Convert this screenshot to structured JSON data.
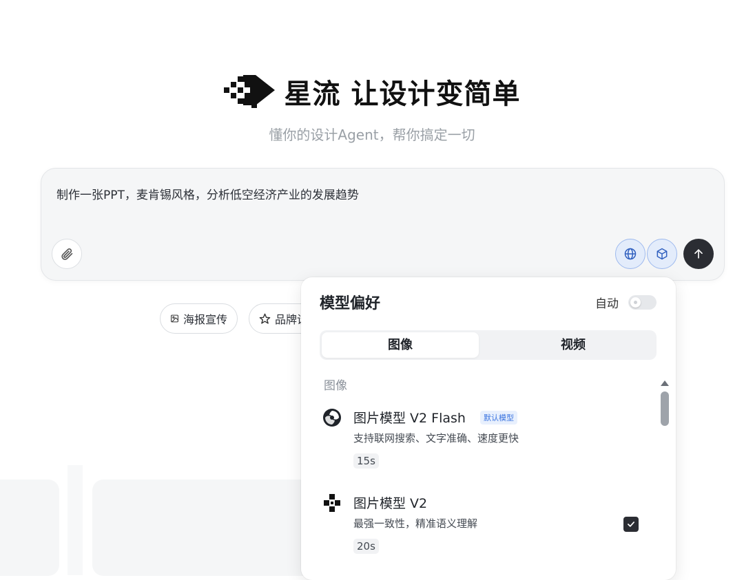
{
  "hero": {
    "logo_icon": "xingliu-logo-icon",
    "title": "星流 让设计变简单",
    "subtitle": "懂你的设计Agent，帮你搞定一切"
  },
  "composer": {
    "prompt": "制作一张PPT，麦肯锡风格，分析低空经济产业的发展趋势",
    "attach_icon": "paperclip-icon",
    "web_search_icon": "globe-icon",
    "model_icon": "cube-icon",
    "send_icon": "arrow-up-icon",
    "accent_color": "#9db9ee"
  },
  "chips": [
    {
      "label": "海报宣传",
      "icon": "image-icon"
    },
    {
      "label": "品牌设",
      "icon": "star-icon"
    }
  ],
  "model_panel": {
    "title": "模型偏好",
    "auto_label": "自动",
    "auto_enabled": false,
    "tabs": [
      {
        "label": "图像",
        "active": true
      },
      {
        "label": "视频",
        "active": false
      }
    ],
    "section_label": "图像",
    "models": [
      {
        "name": "图片模型 V2 Flash",
        "badge": "默认模型",
        "description": "支持联网搜索、文字准确、速度更快",
        "time": "15s",
        "selected": false,
        "icon": "swirl-logo-icon"
      },
      {
        "name": "图片模型 V2",
        "badge": "",
        "description": "最强一致性，精准语义理解",
        "time": "20s",
        "selected": true,
        "icon": "xingliu-logo-icon"
      }
    ]
  }
}
